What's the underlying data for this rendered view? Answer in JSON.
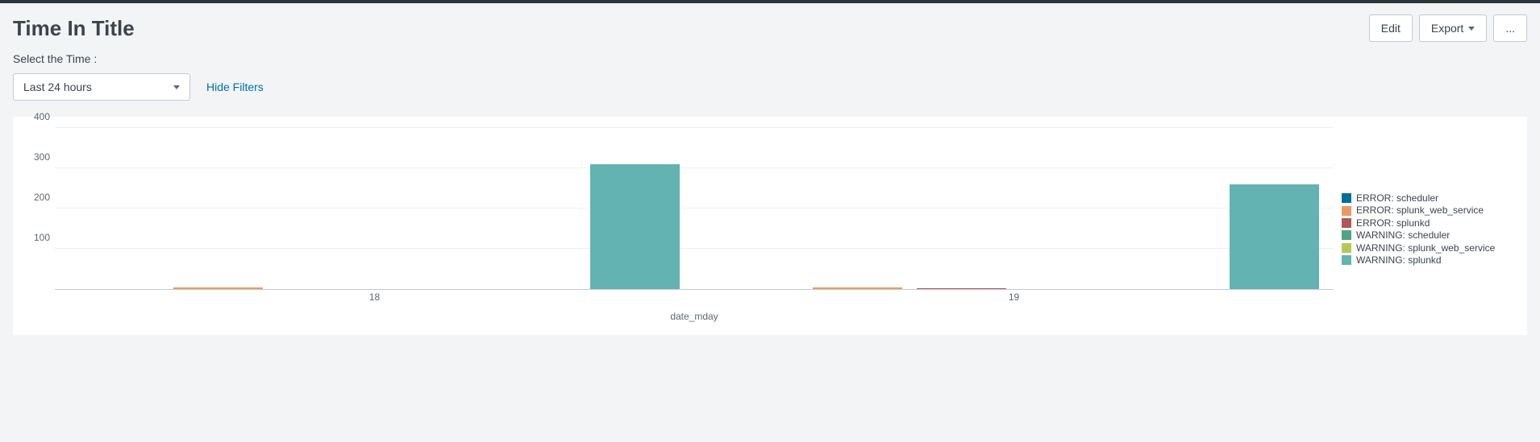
{
  "header": {
    "title": "Time In Title",
    "edit_label": "Edit",
    "export_label": "Export",
    "more_label": "..."
  },
  "filters": {
    "label": "Select the Time :",
    "time_picker_value": "Last 24 hours",
    "hide_filters_label": "Hide Filters"
  },
  "chart_data": {
    "type": "bar",
    "categories": [
      "18",
      "19"
    ],
    "series": [
      {
        "name": "ERROR: scheduler",
        "color": "#006d9c",
        "values": [
          0,
          0
        ]
      },
      {
        "name": "ERROR: splunk_web_service",
        "color": "#ec9960",
        "values": [
          5,
          5
        ]
      },
      {
        "name": "ERROR: splunkd",
        "color": "#af575a",
        "values": [
          0,
          3
        ]
      },
      {
        "name": "WARNING: scheduler",
        "color": "#4fa484",
        "values": [
          0,
          0
        ]
      },
      {
        "name": "WARNING: splunk_web_service",
        "color": "#b6c75a",
        "values": [
          0,
          0
        ]
      },
      {
        "name": "WARNING: splunkd",
        "color": "#62b3b2",
        "values": [
          310,
          260
        ]
      }
    ],
    "xlabel": "date_mday",
    "ylabel": "",
    "ylim": [
      0,
      400
    ],
    "y_ticks": [
      100,
      200,
      300,
      400
    ]
  }
}
